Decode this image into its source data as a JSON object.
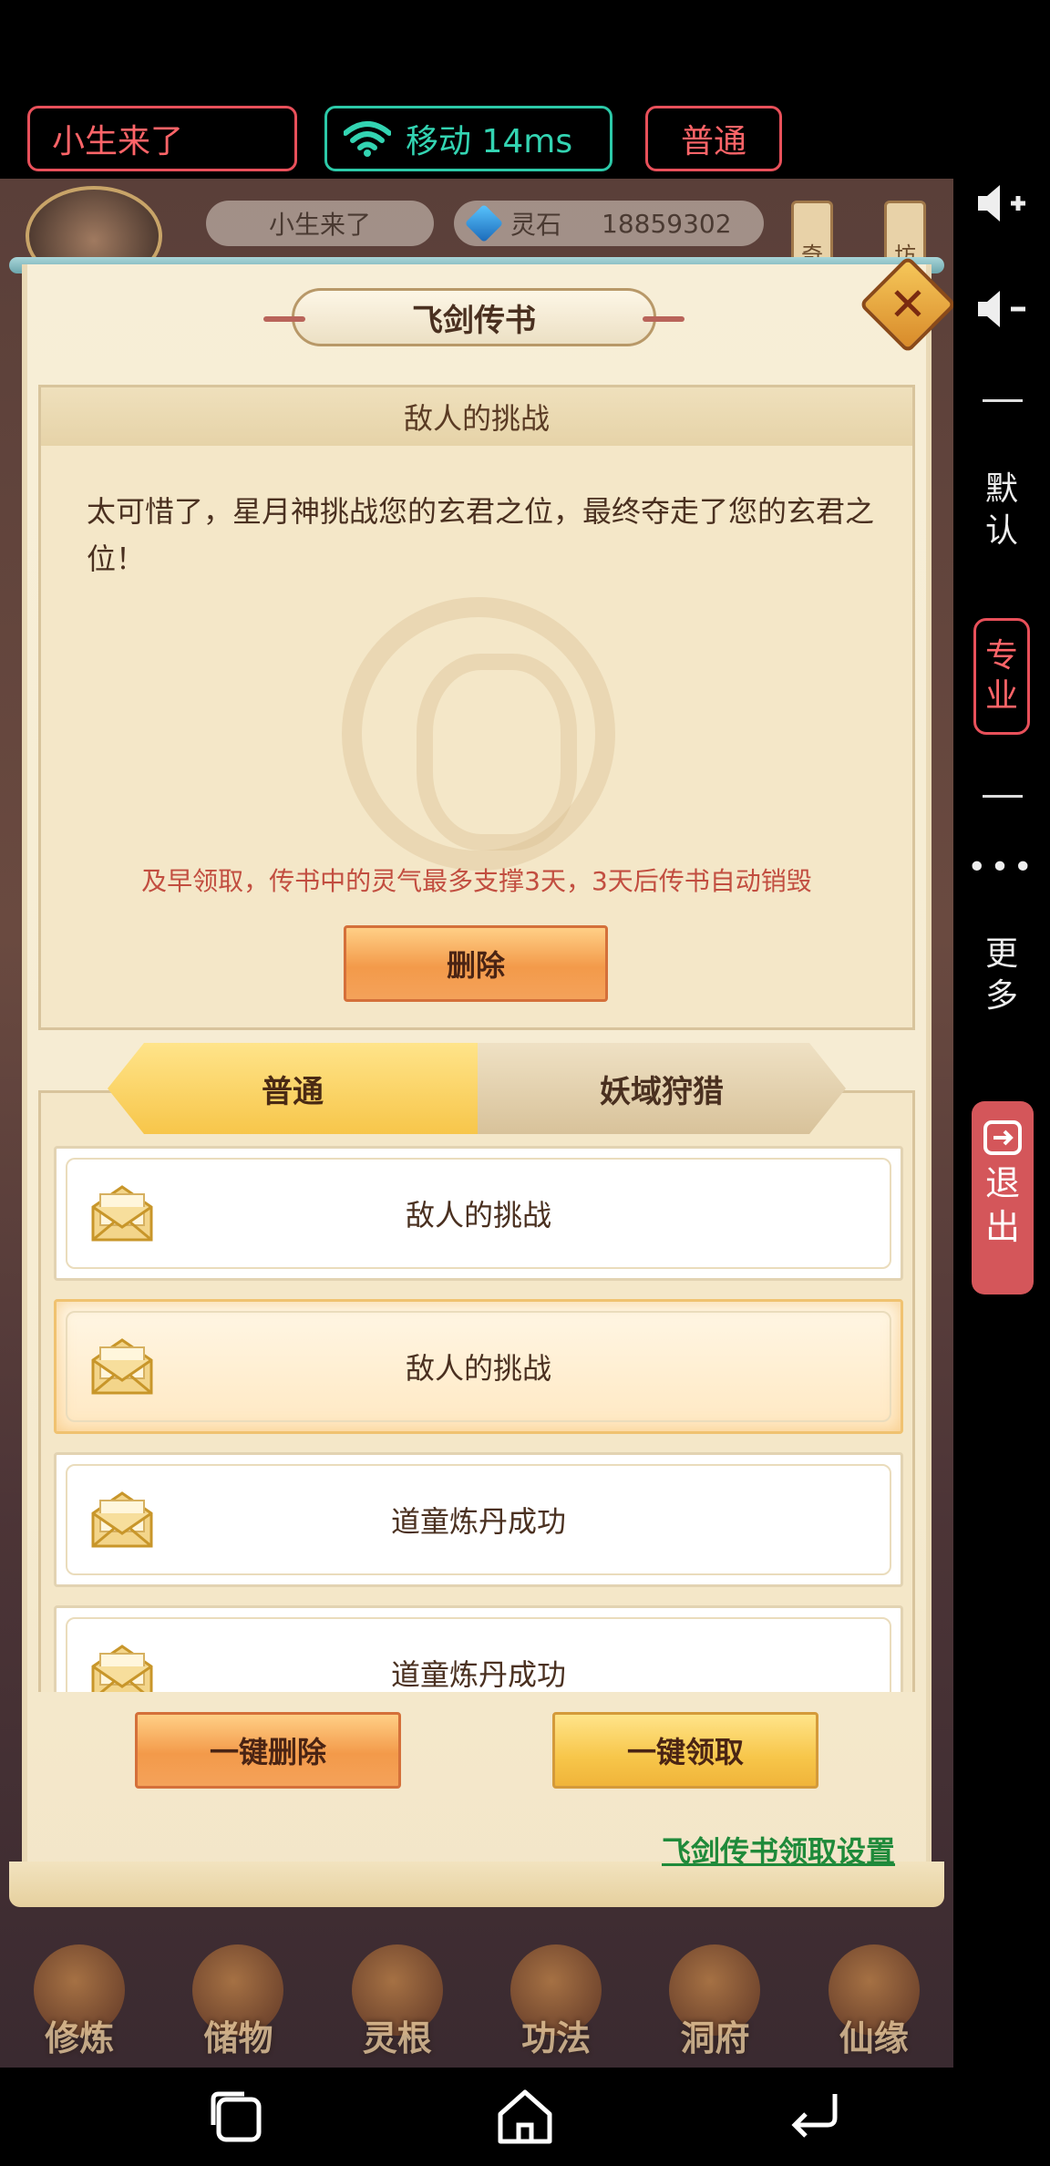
{
  "topbar": {
    "player_name": "小生来了",
    "network_label": "移动 14ms",
    "mode_label": "普通"
  },
  "rail": {
    "volume_up_icon": "volume-up-icon",
    "volume_down_icon": "volume-down-icon",
    "default_label": "默认",
    "pro_label": "专业",
    "more_label": "更多",
    "exit_label": "退出"
  },
  "hud": {
    "name": "小生来了",
    "stone_label": "灵石",
    "stone_value": "18859302",
    "side_tabs": [
      "奇",
      "坊"
    ]
  },
  "dialog": {
    "title": "飞剑传书",
    "detail_title": "敌人的挑战",
    "detail_text": "太可惜了，星月神挑战您的玄君之位，最终夺走了您的玄君之位！",
    "notice": "及早领取，传书中的灵气最多支撑3天，3天后传书自动销毁",
    "delete_label": "删除",
    "tabs": [
      {
        "label": "普通",
        "active": true
      },
      {
        "label": "妖域狩猎",
        "active": false
      }
    ],
    "mails": [
      {
        "title": "敌人的挑战",
        "selected": false
      },
      {
        "title": "敌人的挑战",
        "selected": true
      },
      {
        "title": "道童炼丹成功",
        "selected": false
      },
      {
        "title": "道童炼丹成功",
        "selected": false
      }
    ],
    "delete_all_label": "一键删除",
    "claim_all_label": "一键领取",
    "settings_link": "飞剑传书领取设置"
  },
  "bottom_nav": [
    "修炼",
    "储物",
    "灵根",
    "功法",
    "洞府",
    "仙缘"
  ],
  "colors": {
    "accent_red": "#e8505a",
    "accent_teal": "#2cc9a8",
    "link_green": "#1f8a3a",
    "notice_red": "#c24e40"
  }
}
